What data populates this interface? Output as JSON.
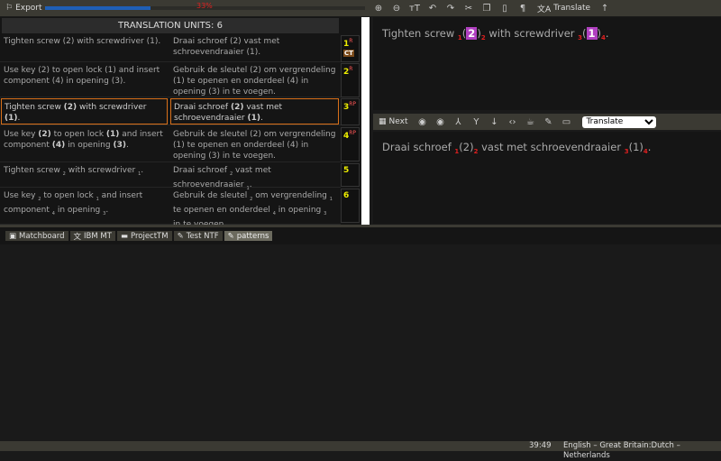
{
  "toolbar": {
    "export_label": "Export",
    "progress_percent": 33,
    "progress_text": "33%",
    "right_icons": [
      "zoom-in-icon",
      "zoom-out-icon",
      "font-size-icon",
      "undo-icon",
      "redo-icon",
      "cut-icon",
      "copy-icon",
      "paste-icon",
      "pilcrow-icon"
    ],
    "translate_label": "Translate"
  },
  "table": {
    "header": "TRANSLATION UNITS: 6",
    "rows": [
      {
        "num": "1",
        "flags": "R",
        "extra": "CT"
      },
      {
        "num": "2",
        "flags": "R"
      },
      {
        "num": "3",
        "flags": "RP"
      },
      {
        "num": "4",
        "flags": "RP"
      },
      {
        "num": "5",
        "flags": ""
      },
      {
        "num": "6",
        "flags": ""
      }
    ]
  },
  "source_editor": {
    "t1": "Tighten screw ",
    "t2": " with screwdriver ",
    "t3": ".",
    "p1": "2",
    "p2": "1",
    "tags": [
      "1",
      "2",
      "3",
      "4"
    ],
    "lp": "(",
    "rp": ")"
  },
  "target_toolbar": {
    "next_label": "Next",
    "mode_select": "Translate"
  },
  "target_editor": {
    "t1": "Draai schroef ",
    "m1": "(2)",
    "t2": " vast met schroevendraaier ",
    "m2": "(1)",
    "t3": ".",
    "tags": [
      "1",
      "2",
      "3",
      "4"
    ]
  },
  "tabs": [
    "Matchboard",
    "IBM MT",
    "ProjectTM",
    "Test NTF",
    "patterns"
  ],
  "status": {
    "time": "39:49",
    "languages": "English – Great Britain:Dutch – Netherlands"
  },
  "colors": {
    "accent_selected": "#d8701a",
    "tag": "#e02020",
    "placeholder": "#b040c0",
    "progress": "#1f5fb5"
  }
}
